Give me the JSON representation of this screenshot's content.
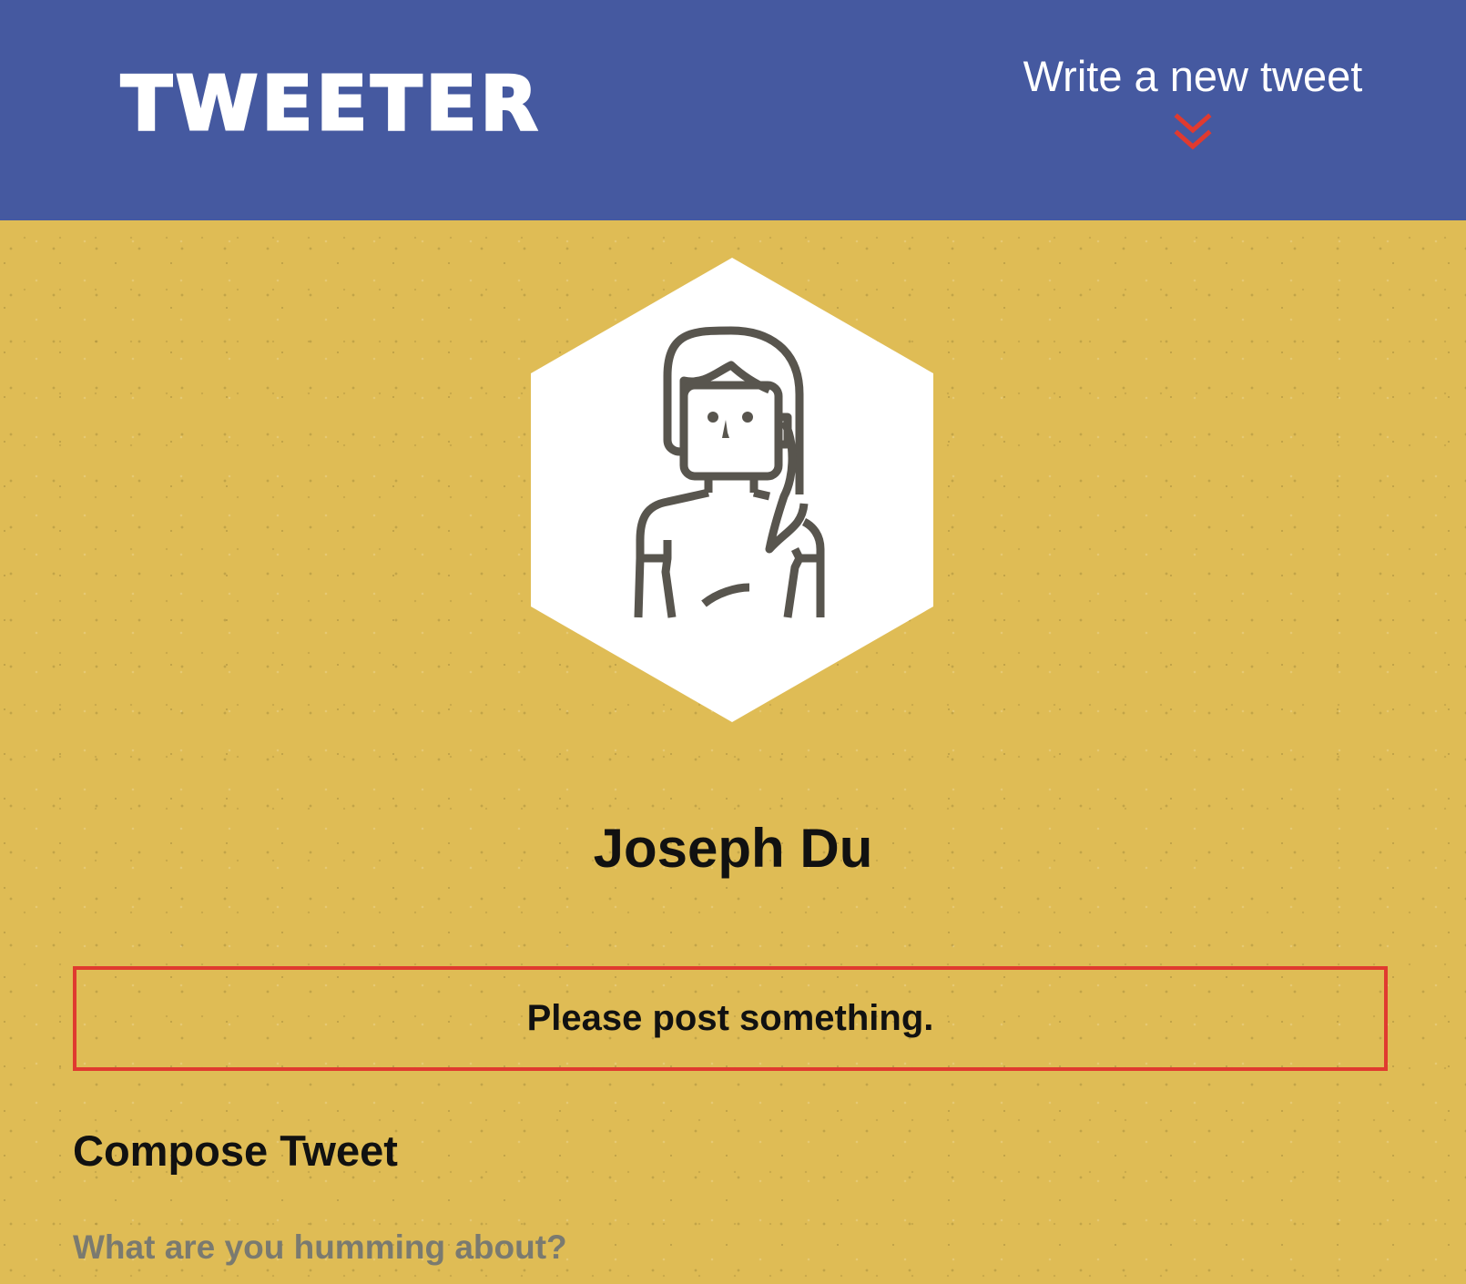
{
  "header": {
    "brand": "TWEETER",
    "compose_toggle_label": "Write a new tweet",
    "compose_toggle_icon": "double-chevron-down-icon"
  },
  "profile": {
    "avatar_icon": "user-avatar-icon",
    "name": "Joseph Du"
  },
  "error": {
    "message": "Please post something."
  },
  "compose": {
    "heading": "Compose Tweet",
    "placeholder": "What are you humming about?",
    "value": ""
  },
  "colors": {
    "header_bg": "#4559a0",
    "page_bg": "#dfbc55",
    "accent_red": "#e03a2f",
    "text_dark": "#111111",
    "placeholder": "#7a7a70"
  }
}
